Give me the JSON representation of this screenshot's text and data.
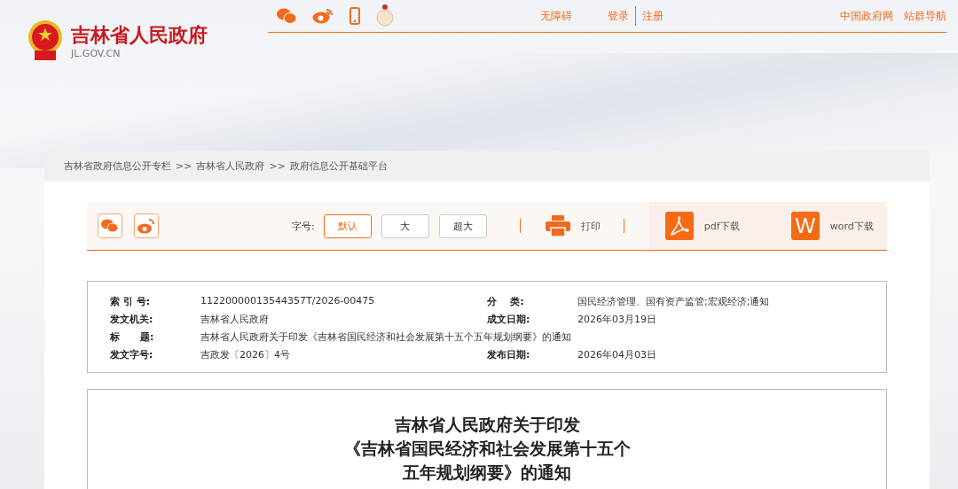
{
  "header": {
    "site_name": "吉林省人民政府",
    "domain": "JL.GOV.CN"
  },
  "top_links": [
    {
      "label": "无障碍"
    },
    {
      "label": "登录"
    },
    {
      "label": "注册"
    }
  ],
  "top_right_links": [
    {
      "label": "中国政府网"
    },
    {
      "label": "站群导航"
    }
  ],
  "breadcrumb": [
    "吉林省政府信息公开专栏",
    ">>",
    "吉林省人民政府",
    ">>",
    "政府信息公开基础平台"
  ],
  "toolbar": {
    "font_size_label": "字号:",
    "font_sizes": [
      {
        "label": "默认",
        "selected": true
      },
      {
        "label": "大",
        "selected": false
      },
      {
        "label": "超大",
        "selected": false
      }
    ],
    "actions": [
      {
        "kind": "print",
        "label": "打印"
      },
      {
        "kind": "pdf",
        "label": "pdf下载"
      },
      {
        "kind": "word",
        "label": "word下载",
        "icon_text": "W"
      }
    ]
  },
  "meta": [
    [
      {
        "label": "索 引 号:",
        "value": "11220000013544357T/2026-00475"
      },
      {
        "label": "分    类:",
        "value": "国民经济管理、国有资产监管;宏观经济;通知"
      }
    ],
    [
      {
        "label": "发文机关:",
        "value": "吉林省人民政府"
      },
      {
        "label": "成文日期:",
        "value": "2026年03月19日"
      }
    ],
    [
      {
        "label": "标      题:",
        "value": "吉林省人民政府关于印发《吉林省国民经济和社会发展第十五个五年规划纲要》的通知"
      }
    ],
    [
      {
        "label": "发文字号:",
        "value": "吉政发〔2026〕4号"
      },
      {
        "label": "发布日期:",
        "value": "2026年04月03日"
      }
    ]
  ],
  "document_title": [
    "吉林省人民政府关于印发",
    "《吉林省国民经济和社会发展第十五个",
    "五年规划纲要》的通知"
  ]
}
